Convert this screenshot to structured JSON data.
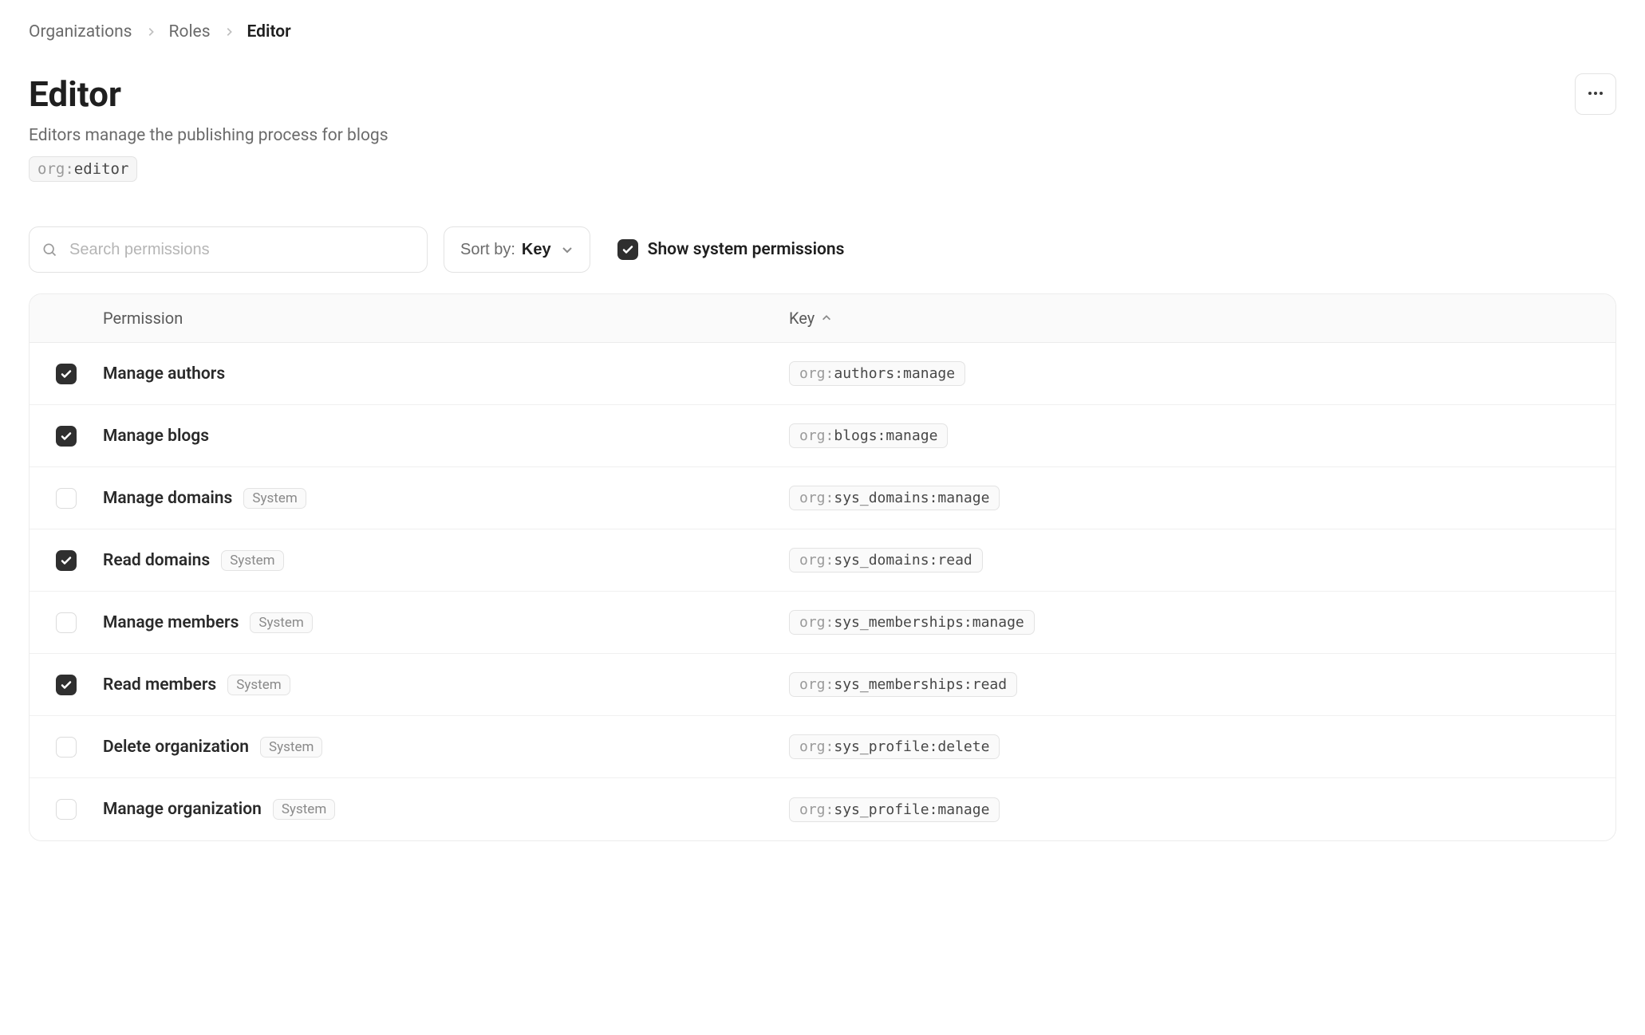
{
  "breadcrumb": {
    "items": [
      "Organizations",
      "Roles"
    ],
    "current": "Editor"
  },
  "header": {
    "title": "Editor",
    "subtitle": "Editors manage the publishing process for blogs",
    "key_prefix": "org:",
    "key_value": "editor"
  },
  "toolbar": {
    "search_placeholder": "Search permissions",
    "search_value": "",
    "sort_label": "Sort by:",
    "sort_value": "Key",
    "show_system_label": "Show system permissions",
    "show_system_checked": true
  },
  "table": {
    "columns": {
      "permission": "Permission",
      "key": "Key"
    },
    "system_badge": "System",
    "rows": [
      {
        "checked": true,
        "name": "Manage authors",
        "system": false,
        "key_prefix": "org:",
        "key_value": "authors:manage"
      },
      {
        "checked": true,
        "name": "Manage blogs",
        "system": false,
        "key_prefix": "org:",
        "key_value": "blogs:manage"
      },
      {
        "checked": false,
        "name": "Manage domains",
        "system": true,
        "key_prefix": "org:",
        "key_value": "sys_domains:manage"
      },
      {
        "checked": true,
        "name": "Read domains",
        "system": true,
        "key_prefix": "org:",
        "key_value": "sys_domains:read"
      },
      {
        "checked": false,
        "name": "Manage members",
        "system": true,
        "key_prefix": "org:",
        "key_value": "sys_memberships:manage"
      },
      {
        "checked": true,
        "name": "Read members",
        "system": true,
        "key_prefix": "org:",
        "key_value": "sys_memberships:read"
      },
      {
        "checked": false,
        "name": "Delete organization",
        "system": true,
        "key_prefix": "org:",
        "key_value": "sys_profile:delete"
      },
      {
        "checked": false,
        "name": "Manage organization",
        "system": true,
        "key_prefix": "org:",
        "key_value": "sys_profile:manage"
      }
    ]
  }
}
